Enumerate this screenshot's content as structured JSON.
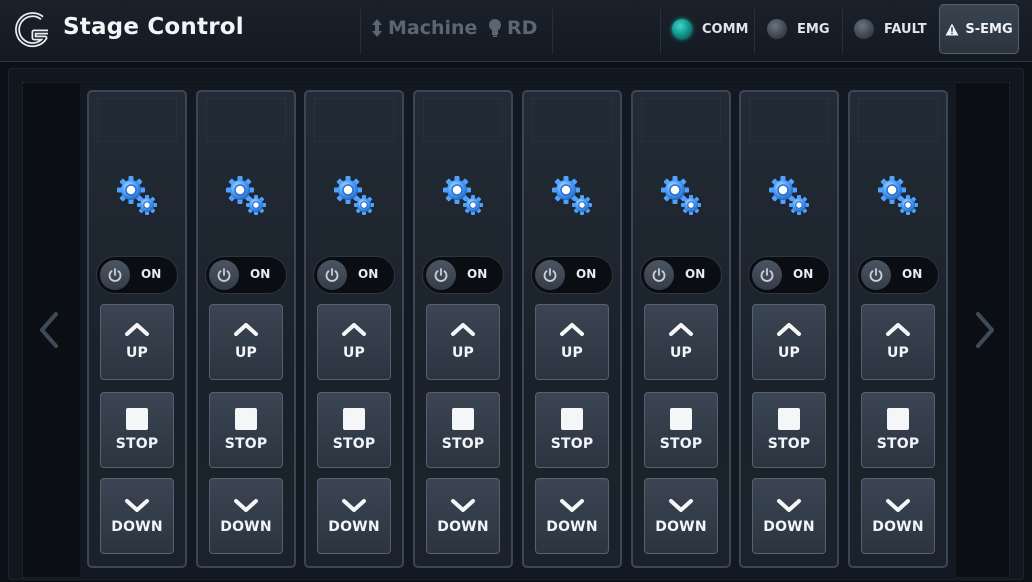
{
  "header": {
    "title": "Stage Control",
    "logo_icon": "g-logo-icon",
    "modes": [
      {
        "label": "Machine",
        "icon": "up-down-arrow-icon"
      },
      {
        "label": "RD",
        "icon": "lightbulb-icon"
      }
    ],
    "status": [
      {
        "label": "COMM",
        "state": "on",
        "color": "#14a89c"
      },
      {
        "label": "EMG",
        "state": "off",
        "color": "#4a525d"
      },
      {
        "label": "FAULT",
        "state": "off",
        "color": "#4a525d"
      }
    ],
    "semg_button": {
      "label": "S-EMG",
      "icon": "warning-icon"
    }
  },
  "navigation": {
    "prev_icon": "chevron-left-icon",
    "next_icon": "chevron-right-icon"
  },
  "stages": [
    {
      "icon": "gears-icon",
      "toggle_label": "ON",
      "up_label": "UP",
      "stop_label": "STOP",
      "down_label": "DOWN"
    },
    {
      "icon": "gears-icon",
      "toggle_label": "ON",
      "up_label": "UP",
      "stop_label": "STOP",
      "down_label": "DOWN"
    },
    {
      "icon": "gears-icon",
      "toggle_label": "ON",
      "up_label": "UP",
      "stop_label": "STOP",
      "down_label": "DOWN"
    },
    {
      "icon": "gears-icon",
      "toggle_label": "ON",
      "up_label": "UP",
      "stop_label": "STOP",
      "down_label": "DOWN"
    },
    {
      "icon": "gears-icon",
      "toggle_label": "ON",
      "up_label": "UP",
      "stop_label": "STOP",
      "down_label": "DOWN"
    },
    {
      "icon": "gears-icon",
      "toggle_label": "ON",
      "up_label": "UP",
      "stop_label": "STOP",
      "down_label": "DOWN"
    },
    {
      "icon": "gears-icon",
      "toggle_label": "ON",
      "up_label": "UP",
      "stop_label": "STOP",
      "down_label": "DOWN"
    },
    {
      "icon": "gears-icon",
      "toggle_label": "ON",
      "up_label": "UP",
      "stop_label": "STOP",
      "down_label": "DOWN"
    }
  ],
  "colors": {
    "accent_gear": "#4fa3ff",
    "comm_led": "#14a89c"
  }
}
